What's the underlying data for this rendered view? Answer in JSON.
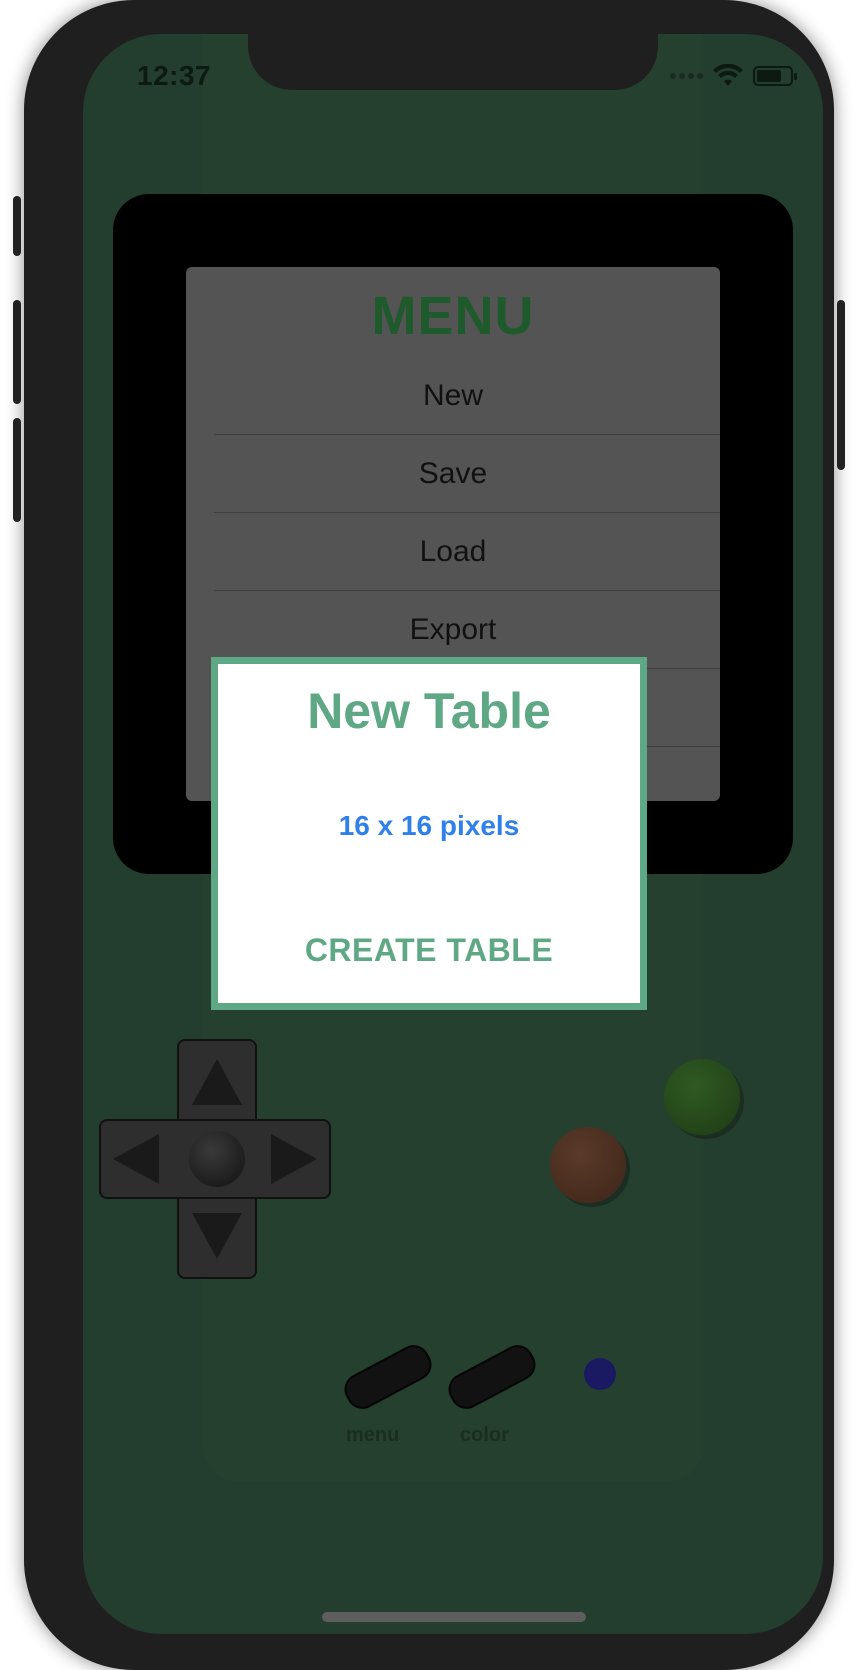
{
  "status_bar": {
    "time": "12:37"
  },
  "menu": {
    "title": "MENU",
    "items": [
      {
        "label": "New"
      },
      {
        "label": "Save"
      },
      {
        "label": "Load"
      },
      {
        "label": "Export"
      },
      {
        "label": ""
      },
      {
        "label": ""
      }
    ]
  },
  "new_table_dialog": {
    "title": "New Table",
    "size_label": "16 x 16 pixels",
    "create_button": "CREATE TABLE"
  },
  "controls": {
    "menu_label": "menu",
    "color_label": "color"
  },
  "colors": {
    "accent_green": "#5fa886",
    "menu_title_green": "#1e5a2b",
    "size_blue": "#2f80ea",
    "screen_bg": "#233d2f"
  }
}
